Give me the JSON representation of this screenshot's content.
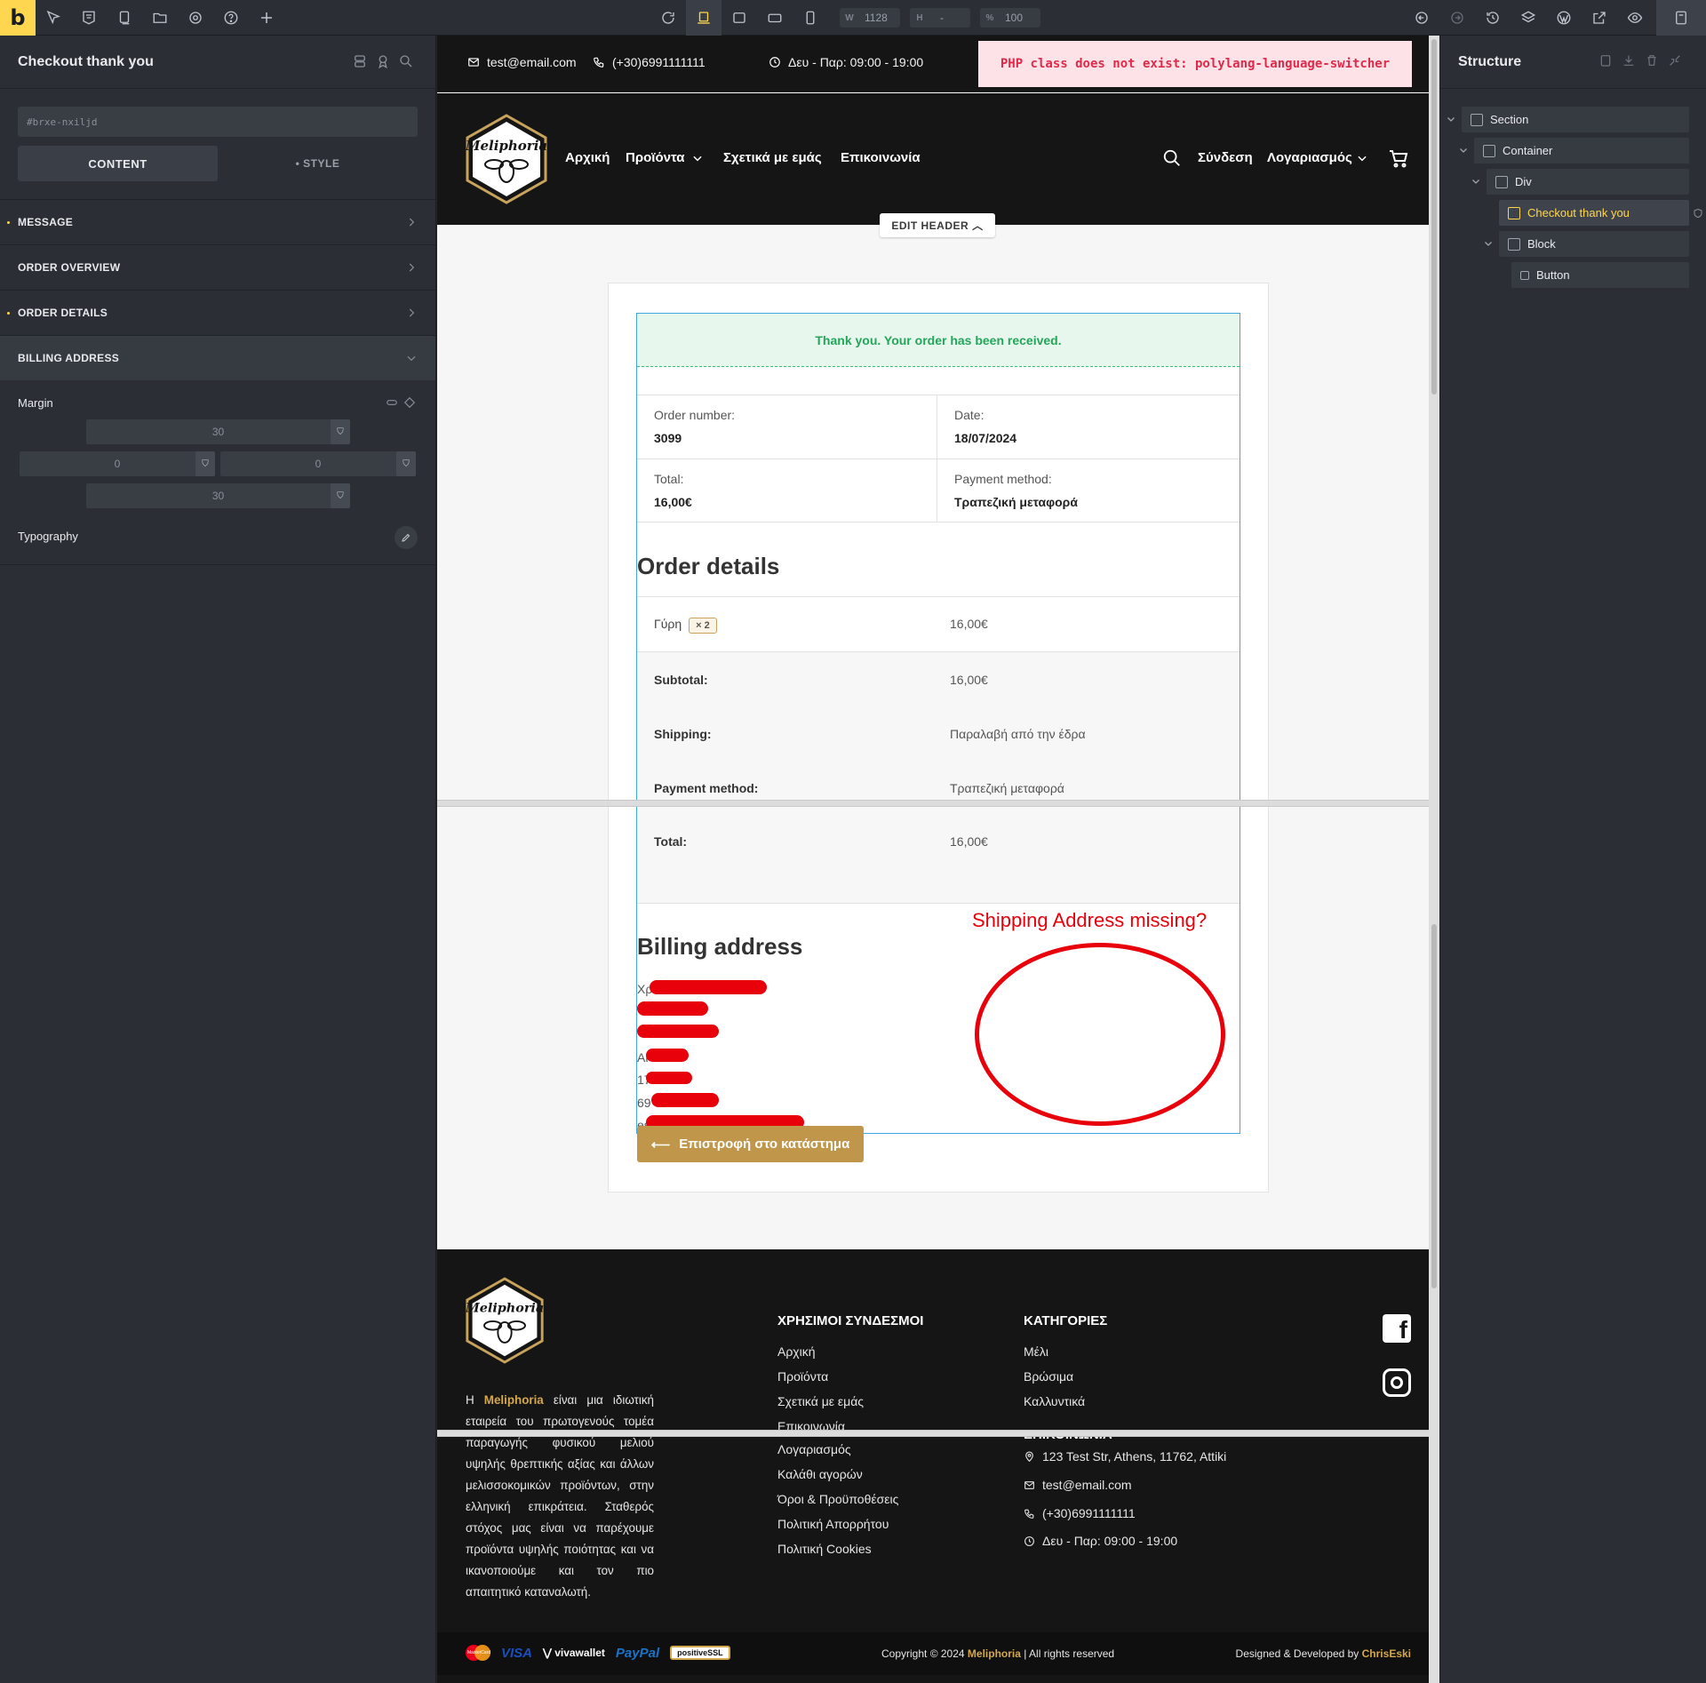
{
  "toolbar": {
    "logo": "b",
    "width_label": "W",
    "width_value": "1128",
    "height_label": "H",
    "height_value": "-",
    "percent_label": "%",
    "percent_value": "100"
  },
  "left_panel": {
    "title": "Checkout thank you",
    "element_id": "#brxe-nxiljd",
    "tab_content": "CONTENT",
    "tab_style": "• STYLE",
    "sections": [
      "MESSAGE",
      "ORDER OVERVIEW",
      "ORDER DETAILS",
      "BILLING ADDRESS"
    ],
    "margin_label": "Margin",
    "margin_top": "30",
    "margin_left": "0",
    "margin_right": "0",
    "margin_bottom": "30",
    "typography_label": "Typography"
  },
  "site": {
    "email": "test@email.com",
    "phone": "(+30)6991111111",
    "hours": "Δευ - Παρ: 09:00 - 19:00",
    "php_error": "PHP class does not exist: polylang-language-switcher",
    "logo_text": "Meliphoria",
    "nav": [
      "Αρχική",
      "Προϊόντα",
      "Σχετικά με εμάς",
      "Επικοινωνία"
    ],
    "login": "Σύνδεση",
    "account": "Λογαριασμός",
    "edit_header": "EDIT HEADER"
  },
  "order": {
    "thanks": "Thank you. Your order has been received.",
    "number_label": "Order number:",
    "number": "3099",
    "date_label": "Date:",
    "date": "18/07/2024",
    "total_label": "Total:",
    "total": "16,00€",
    "payment_label": "Payment method:",
    "payment": "Τραπεζική μεταφορά",
    "details_title": "Order details",
    "item_name": "Γύρη",
    "item_qty": "× 2",
    "item_price": "16,00€",
    "subtotal_label": "Subtotal:",
    "subtotal": "16,00€",
    "shipping_label": "Shipping:",
    "shipping": "Παραλαβή από την έδρα",
    "pm_label": "Payment method:",
    "pm": "Τραπεζική μεταφορά",
    "total2_label": "Total:",
    "total2": "16,00€",
    "billing_title": "Billing address",
    "billing_lines": [
      "Χρ",
      "",
      "",
      "Αι",
      "17",
      "69",
      "es"
    ],
    "annotation": "Shipping Address missing?",
    "back_button": "Επιστροφή στο κατάστημα"
  },
  "footer": {
    "useful_links_title": "ΧΡΗΣΙΜΟΙ ΣΥΝΔΕΣΜΟΙ",
    "useful_links": [
      "Αρχική",
      "Προϊόντα",
      "Σχετικά με εμάς",
      "Επικοινωνία",
      "Λογαριασμός",
      "Καλάθι αγορών",
      "Όροι & Προϋποθέσεις",
      "Πολιτική Απορρήτου",
      "Πολιτική Cookies"
    ],
    "categories_title": "ΚΑΤΗΓΟΡΙΕΣ",
    "categories": [
      "Μέλι",
      "Βρώσιμα",
      "Καλλυντικά"
    ],
    "contact_title": "ΕΠΙΚΟΙΝΩΝΙΑ",
    "address": "123 Test Str, Athens, 11762, Attiki",
    "email": "test@email.com",
    "phone": "(+30)6991111111",
    "hours": "Δευ - Παρ: 09:00 - 19:00",
    "about_prefix": "Η ",
    "about_brand": "Meliphoria",
    "about_text": " είναι μια ιδιωτική εταιρεία του πρωτογενούς τομέα παραγωγής φυσικού μελιού υψηλής θρεπτικής αξίας και άλλων μελισσοκομικών προϊόντων, στην ελληνική επικράτεια. Σταθερός στόχος μας είναι να παρέχουμε προϊόντα υψηλής ποιότητας και να ικανοποιούμε και τον πιο απαιτητικό καταναλωτή.",
    "payments": [
      "MasterCard",
      "VISA",
      "vivawallet",
      "PayPal",
      "positiveSSL"
    ],
    "copyright_prefix": "Copyright © 2024 ",
    "copyright_brand": "Meliphoria",
    "copyright_suffix": " | All rights reserved",
    "designed_prefix": "Designed & Developed by ",
    "designed_brand": "ChrisEski"
  },
  "structure": {
    "title": "Structure",
    "items": [
      "Section",
      "Container",
      "Div",
      "Checkout thank you",
      "Block",
      "Button"
    ]
  },
  "colors": {
    "accent": "#ffd64f",
    "gold": "#bf964a",
    "success": "#22a65a",
    "error": "#e0294a",
    "annotation": "#e8000b"
  }
}
